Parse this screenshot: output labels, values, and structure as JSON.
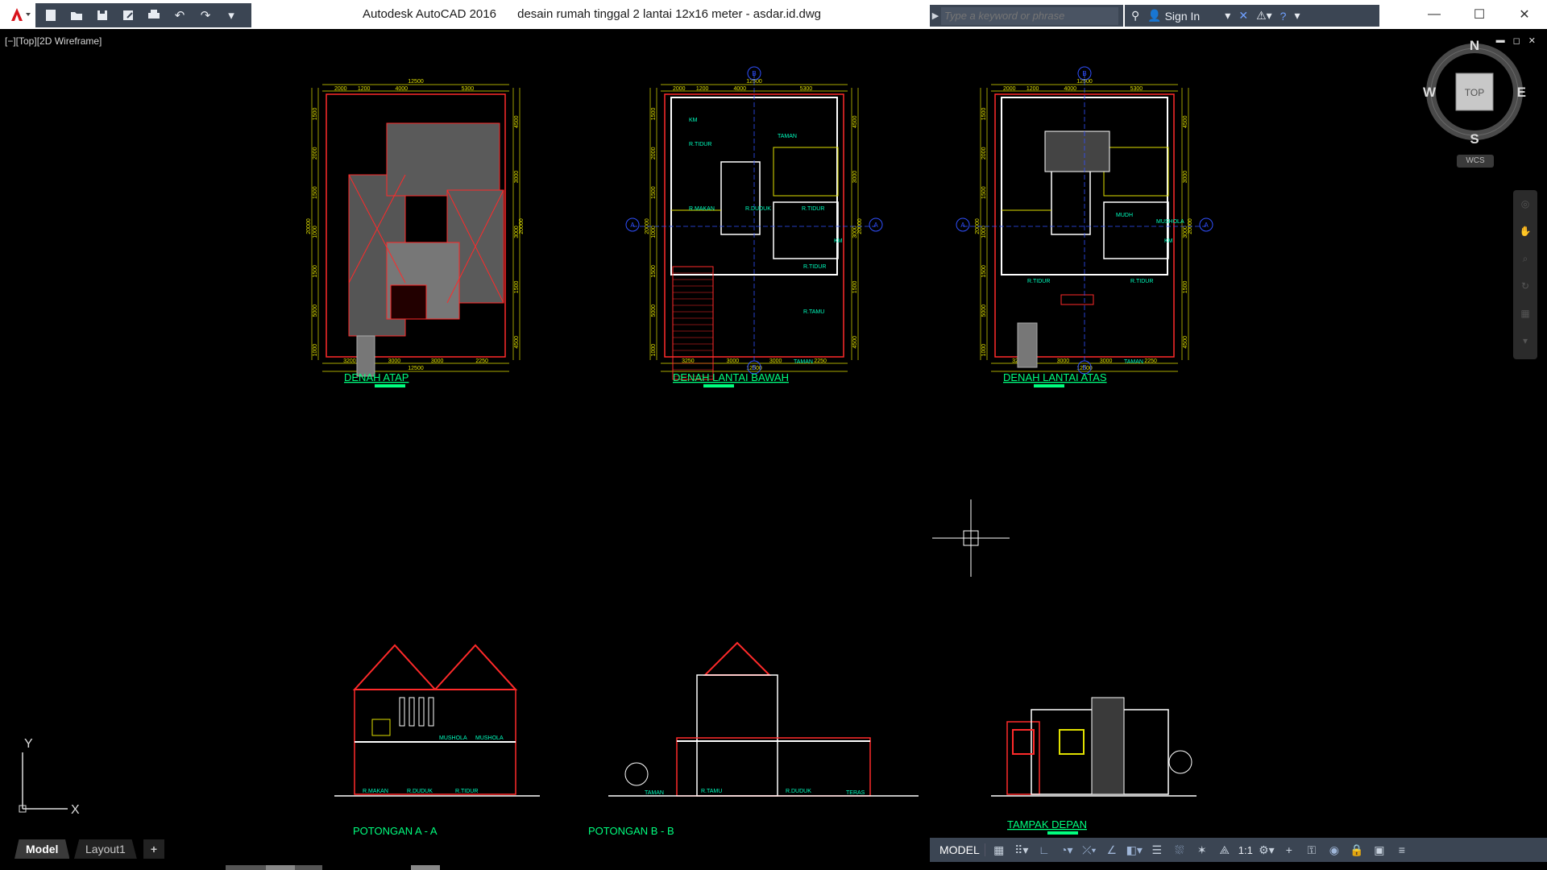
{
  "titlebar": {
    "app_name": "Autodesk AutoCAD 2016",
    "file_name": "desain rumah tinggal 2 lantai 12x16 meter - asdar.id.dwg",
    "search_placeholder": "Type a keyword or phrase",
    "sign_in": "Sign In",
    "qat_icons": [
      "new-icon",
      "open-icon",
      "save-icon",
      "save-as-icon",
      "plot-icon",
      "undo-icon",
      "redo-icon",
      "customize-icon"
    ]
  },
  "viewport": {
    "label": "[−][Top][2D Wireframe]",
    "controls": [
      "▬",
      "◻",
      "✕"
    ]
  },
  "viewcube": {
    "north": "N",
    "south": "S",
    "east": "E",
    "west": "W",
    "face": "TOP",
    "wcs": "WCS"
  },
  "ucs": {
    "x": "X",
    "y": "Y"
  },
  "drawings": {
    "plans": [
      {
        "label": "DENAH ATAP",
        "top_dims": [
          "2000",
          "1200",
          "4000",
          "5300"
        ],
        "top_total": "12500",
        "bottom_dims": [
          "3200",
          "3000",
          "3000",
          "2250"
        ],
        "bottom_total": "12500",
        "left_dims": [
          "1500",
          "2000",
          "1500",
          "1000",
          "1500",
          "5000",
          "1000"
        ],
        "right_dims": [
          "4500",
          "3000",
          "3000",
          "1500",
          "4500"
        ],
        "side_total": "20000",
        "rooms": []
      },
      {
        "label": "DENAH LANTAI BAWAH",
        "top_dims": [
          "2000",
          "1200",
          "4000",
          "5300"
        ],
        "top_total": "12500",
        "bottom_dims": [
          "3250",
          "3000",
          "3000",
          "2250"
        ],
        "bottom_total": "12500",
        "left_dims": [
          "1500",
          "2000",
          "1500",
          "1000",
          "1500",
          "5000",
          "1000"
        ],
        "right_dims": [
          "4500",
          "3000",
          "3000",
          "1500",
          "4500"
        ],
        "side_total": "20000",
        "rooms": [
          "KM",
          "R.TIDUR",
          "TAMAN",
          "R.MAKAN",
          "R.DUDUK",
          "R.TIDUR",
          "KM",
          "R.TIDUR",
          "R.TAMU",
          "TAMAN"
        ]
      },
      {
        "label": "DENAH LANTAI ATAS",
        "top_dims": [
          "2000",
          "1200",
          "4000",
          "5300"
        ],
        "top_total": "12500",
        "bottom_dims": [
          "3250",
          "3000",
          "3000",
          "2250"
        ],
        "bottom_total": "12500",
        "left_dims": [
          "1500",
          "2000",
          "1500",
          "1000",
          "1500",
          "5000",
          "1000"
        ],
        "right_dims": [
          "4500",
          "3000",
          "3000",
          "1500",
          "4500"
        ],
        "side_total": "20000",
        "rooms": [
          "MUDH",
          "MUSHOLA",
          "KM",
          "R.TIDUR",
          "R.TIDUR",
          "TAMAN"
        ]
      }
    ],
    "sections": [
      {
        "label": "POTONGAN A - A",
        "rooms": [
          "R.MAKAN",
          "R.DUDUK",
          "R.TIDUR",
          "MUSHOLA",
          "MUSHOLA"
        ]
      },
      {
        "label": "POTONGAN B - B",
        "rooms": [
          "TAMAN",
          "R.TAMU",
          "R.DUDUK",
          "TERAS"
        ]
      },
      {
        "label": "TAMPAK DEPAN",
        "rooms": []
      }
    ],
    "grid_markers": [
      "B",
      "A"
    ]
  },
  "tabs": [
    "Model",
    "Layout1",
    "+"
  ],
  "statusbar": {
    "model": "MODEL",
    "scale": "1:1",
    "icons": [
      "grid-icon",
      "snap-icon",
      "ortho-icon",
      "polar-icon",
      "osnap-icon",
      "otrack-icon",
      "lineweight-icon",
      "transparency-icon",
      "selection-cycling-icon",
      "annotation-visibility-icon",
      "annotation-scale-icon",
      "workspace-icon",
      "annotation-monitor-icon",
      "units-icon",
      "quick-properties-icon",
      "lock-ui-icon",
      "isolate-icon",
      "hardware-accel-icon",
      "clean-screen-icon",
      "customize-icon"
    ]
  },
  "colors": {
    "background": "#000000",
    "wall_red": "#ff2a2a",
    "wall_white": "#ffffff",
    "dim_yellow": "#e0e000",
    "label_green": "#00ff7f",
    "grid_blue": "#3050ff",
    "ui_panel": "#3b4553"
  }
}
